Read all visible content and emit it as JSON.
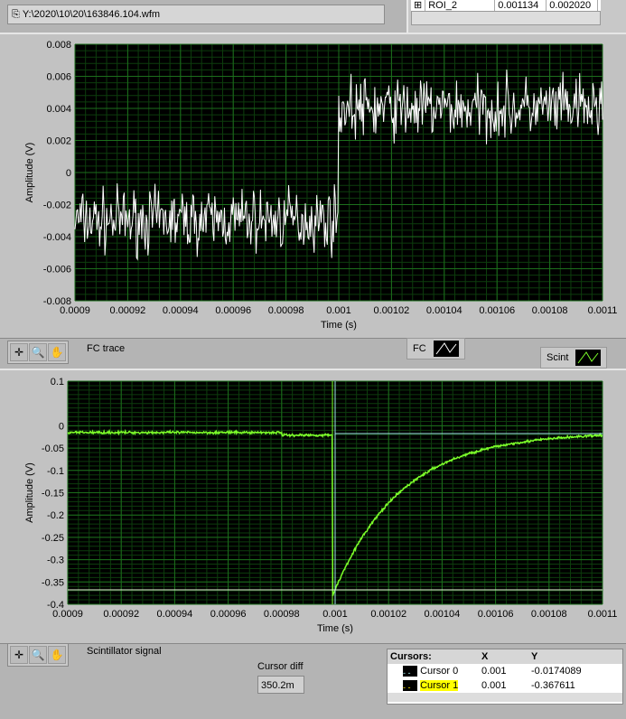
{
  "file_path": "Y:\\2020\\10\\20\\163846.104.wfm",
  "roi_row": {
    "name": "ROI_2",
    "x": "0.001134",
    "y": "0.002020"
  },
  "fc_plot": {
    "title": "FC trace",
    "ylabel": "Amplitude (V)",
    "xlabel": "Time (s)",
    "yticks": [
      "0.008",
      "0.006",
      "0.004",
      "0.002",
      "0",
      "-0.002",
      "-0.004",
      "-0.006",
      "-0.008"
    ],
    "xticks": [
      "0.0009",
      "0.00092",
      "0.00094",
      "0.00096",
      "0.00098",
      "0.001",
      "0.00102",
      "0.00104",
      "0.00106",
      "0.00108",
      "0.0011"
    ]
  },
  "scint_plot": {
    "title": "Scintillator signal",
    "ylabel": "Amplitude (V)",
    "xlabel": "Time (s)",
    "yticks": [
      "0.1",
      "0",
      "-0.05",
      "-0.1",
      "-0.15",
      "-0.2",
      "-0.25",
      "-0.3",
      "-0.35",
      "-0.4"
    ],
    "xticks": [
      "0.0009",
      "0.00092",
      "0.00094",
      "0.00096",
      "0.00098",
      "0.001",
      "0.00102",
      "0.00104",
      "0.00106",
      "0.00108",
      "0.0011"
    ]
  },
  "legend": {
    "fc": "FC",
    "scint": "Scint"
  },
  "cursor_diff": {
    "label": "Cursor diff",
    "value": "350.2m"
  },
  "cursors": {
    "headers": [
      "Cursors:",
      "X",
      "Y"
    ],
    "rows": [
      {
        "name": "Cursor 0",
        "x": "0.001",
        "y": "-0.0174089"
      },
      {
        "name": "Cursor 1",
        "x": "0.001",
        "y": "-0.367611"
      }
    ]
  },
  "colors": {
    "fc_trace": "#ffffff",
    "scint_trace": "#7cff2a",
    "grid": "#1c6e1c",
    "cursor": "#9fe8e8"
  },
  "chart_data": [
    {
      "type": "line",
      "title": "FC trace",
      "xlabel": "Time (s)",
      "ylabel": "Amplitude (V)",
      "xlim": [
        0.0009,
        0.0011
      ],
      "ylim": [
        -0.008,
        0.008
      ],
      "series": [
        {
          "name": "FC",
          "description_values": {
            "baseline_before_0.001": -0.003,
            "baseline_after_0.001": 0.004,
            "noise_amplitude": 0.0015
          }
        }
      ]
    },
    {
      "type": "line",
      "title": "Scintillator signal",
      "xlabel": "Time (s)",
      "ylabel": "Amplitude (V)",
      "xlim": [
        0.0009,
        0.0011
      ],
      "ylim": [
        -0.4,
        0.1
      ],
      "series": [
        {
          "name": "Scint",
          "description_values": {
            "baseline": -0.015,
            "minimum": -0.3676,
            "minimum_time": 0.001,
            "decay_time_constant": 2.5e-05
          }
        }
      ]
    }
  ]
}
